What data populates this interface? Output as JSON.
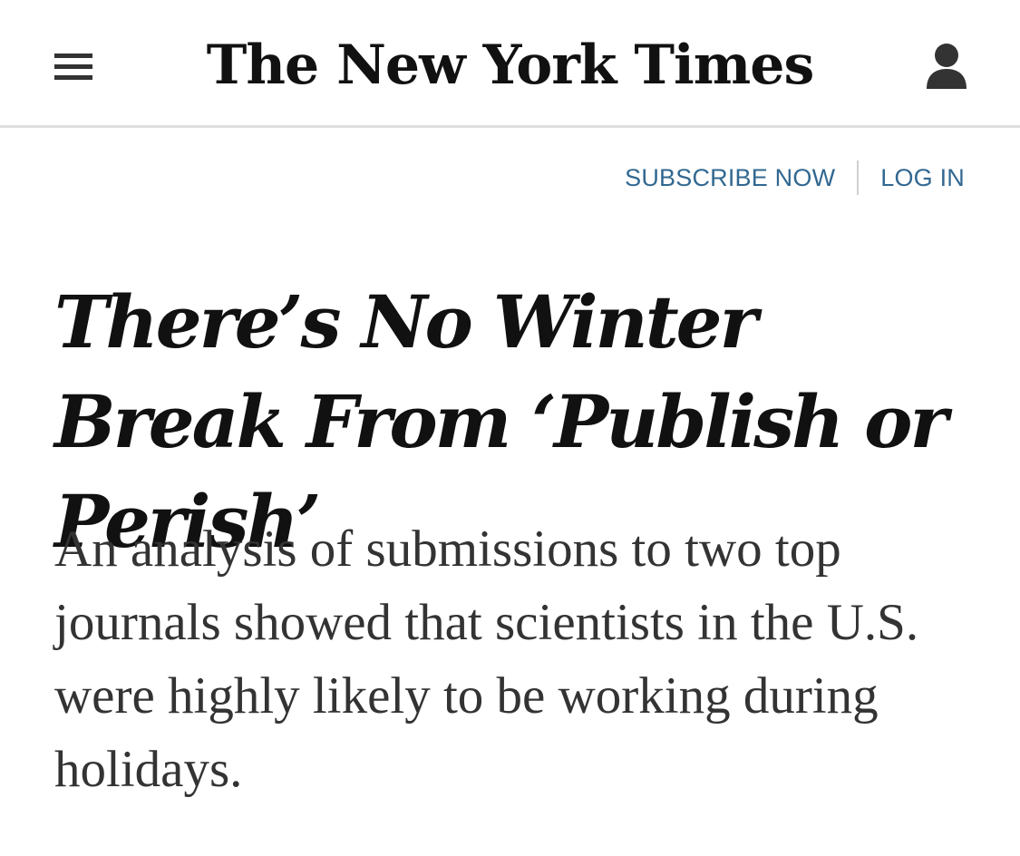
{
  "masthead": {
    "logo_text": "The New York Times",
    "menu_icon": "hamburger-menu-icon",
    "account_icon": "user-account-icon"
  },
  "nav": {
    "subscribe_label": "SUBSCRIBE NOW",
    "login_label": "LOG IN",
    "link_color": "#326891"
  },
  "article": {
    "headline": "There’s No Winter Break From ‘Publish or Perish’",
    "summary": "An analysis of submissions to two top journals showed that scientists in the U.S. were highly likely to be working during holidays."
  }
}
